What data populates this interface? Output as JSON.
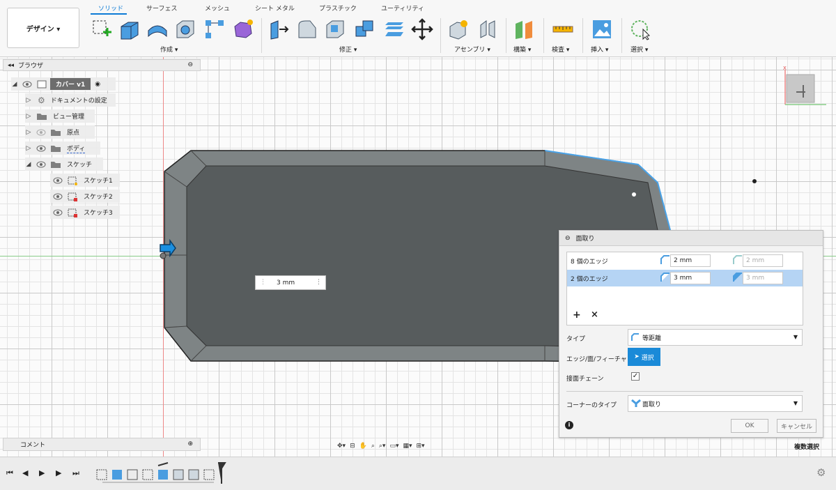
{
  "workspace": {
    "label": "デザイン ▾"
  },
  "tabs": [
    "ソリッド",
    "サーフェス",
    "メッシュ",
    "シート メタル",
    "プラスチック",
    "ユーティリティ"
  ],
  "groups": {
    "create": "作成 ▾",
    "modify": "修正 ▾",
    "assemble": "アセンブリ ▾",
    "construct": "構築 ▾",
    "inspect": "検査 ▾",
    "insert": "挿入 ▾",
    "select": "選択 ▾"
  },
  "browser": {
    "title": "ブラウザ",
    "root": "カバー v1",
    "items": [
      "ドキュメントの設定",
      "ビュー管理",
      "原点",
      "ボディ",
      "スケッチ"
    ],
    "sketches": [
      "スケッチ1",
      "スケッチ2",
      "スケッチ3"
    ]
  },
  "comment": {
    "title": "コメント"
  },
  "dimension": {
    "value": "3 mm"
  },
  "dialog": {
    "title": "面取り",
    "rows": [
      {
        "label": "8 個のエッジ",
        "dist1": "2 mm",
        "dist2": "2 mm"
      },
      {
        "label": "2 個のエッジ",
        "dist1": "3 mm",
        "dist2": "3 mm"
      }
    ],
    "type_label": "タイプ",
    "type_value": "等距離",
    "edge_label": "エッジ/面/フィーチャ",
    "select_btn": "選択",
    "chain_label": "接面チェーン",
    "corner_label": "コーナーのタイプ",
    "corner_value": "面取り",
    "ok": "OK",
    "cancel": "キャンセル"
  },
  "status": {
    "mode": "複数選択"
  },
  "colors": {
    "accent": "#0c7bd6",
    "body": "#565b5c",
    "selected_row": "#b5d4f4"
  }
}
